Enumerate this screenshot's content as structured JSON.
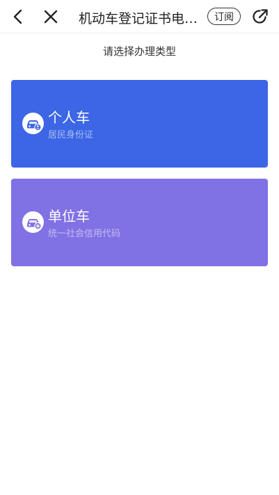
{
  "header": {
    "title": "机动车登记证书电子化",
    "subscribe_label": "订阅",
    "icons": [
      "back-icon",
      "close-icon",
      "share-icon"
    ]
  },
  "prompt": "请选择办理类型",
  "cards": [
    {
      "title": "个人车",
      "subtitle": "居民身份证",
      "color": "#3c66e5",
      "icon": "car-person-icon"
    },
    {
      "title": "单位车",
      "subtitle": "统一社会信用代码",
      "color": "#8071e4",
      "icon": "car-building-icon"
    }
  ],
  "colors": {
    "personal_card": "#3c66e5",
    "unit_card": "#8071e4",
    "text_dark": "#222222"
  }
}
